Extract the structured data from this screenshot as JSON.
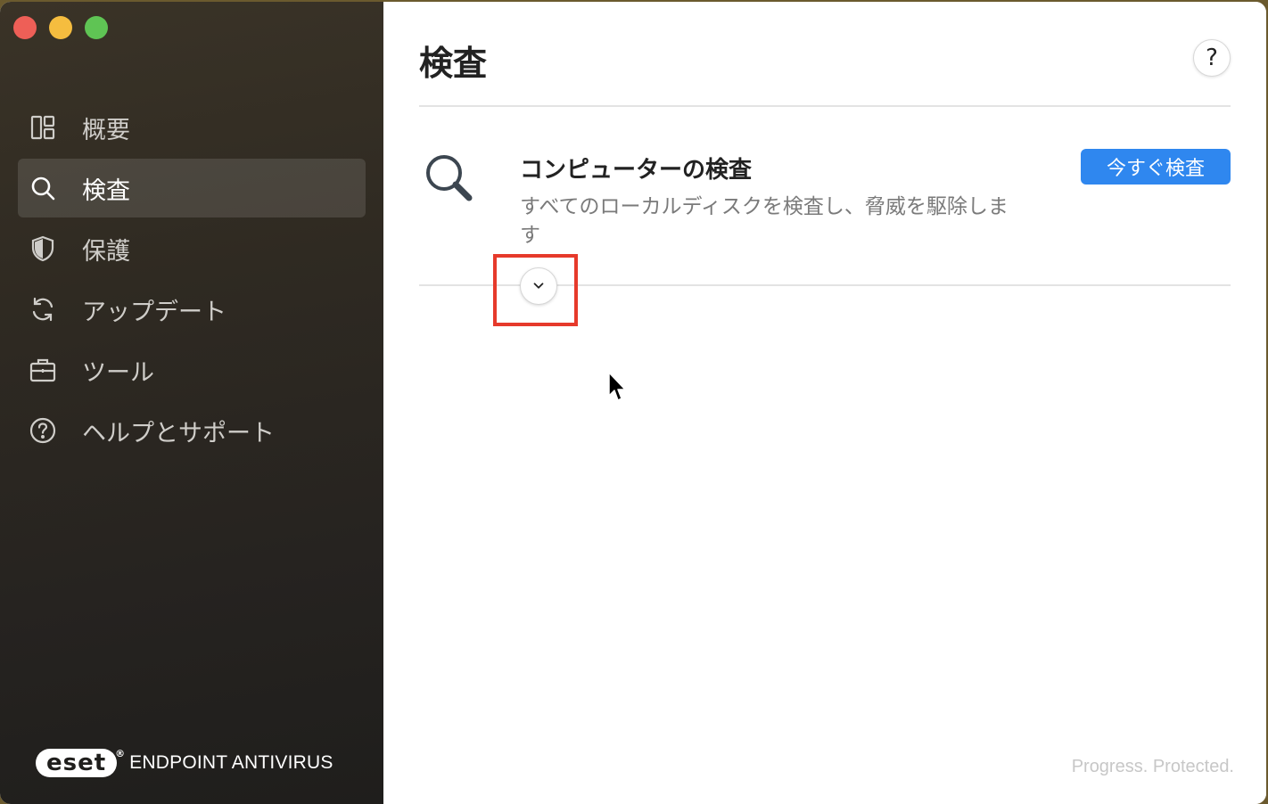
{
  "window": {
    "controls": [
      "close",
      "minimize",
      "maximize"
    ]
  },
  "sidebar": {
    "items": [
      {
        "label": "概要",
        "icon": "dashboard-icon"
      },
      {
        "label": "検査",
        "icon": "search-icon",
        "active": true
      },
      {
        "label": "保護",
        "icon": "shield-icon"
      },
      {
        "label": "アップデート",
        "icon": "refresh-icon"
      },
      {
        "label": "ツール",
        "icon": "toolbox-icon"
      },
      {
        "label": "ヘルプとサポート",
        "icon": "help-circle-icon"
      }
    ],
    "brand": {
      "logo": "eset",
      "product": "ENDPOINT ANTIVIRUS"
    }
  },
  "main": {
    "title": "検査",
    "help_label": "?",
    "scan": {
      "title": "コンピューターの検査",
      "description": "すべてのローカルディスクを検査し、脅威を駆除します",
      "button_label": "今すぐ検査"
    },
    "tagline": "Progress. Protected."
  },
  "colors": {
    "accent": "#2f87ef",
    "highlight": "#e63a2b"
  }
}
